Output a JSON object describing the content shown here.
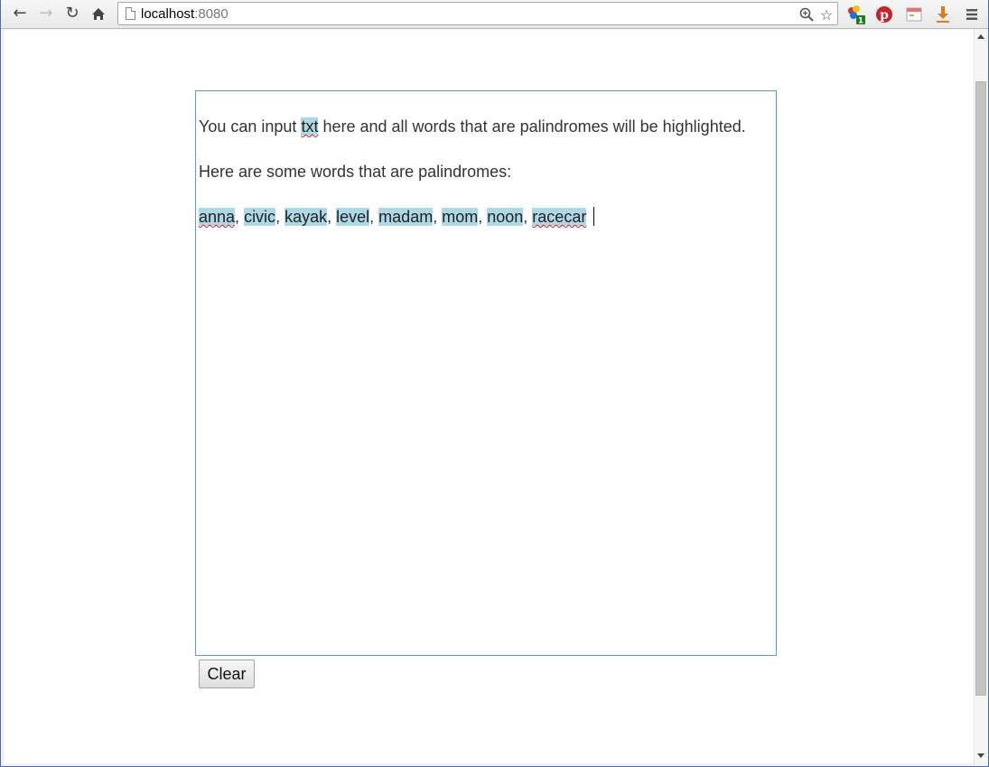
{
  "browser": {
    "url_host": "localhost",
    "url_port": ":8080",
    "icons": {
      "back": "back-arrow-icon",
      "forward": "forward-arrow-icon",
      "reload": "reload-icon",
      "home": "home-icon",
      "zoom": "zoom-icon",
      "bookmark": "star-icon",
      "menu": "hamburger-menu-icon"
    },
    "extensions": [
      {
        "name": "extension-multicolor-icon",
        "badge": "1"
      },
      {
        "name": "pinterest-icon"
      },
      {
        "name": "calendar-extension-icon"
      },
      {
        "name": "download-icon"
      }
    ]
  },
  "editor": {
    "line1": {
      "before": "You can input ",
      "highlighted": "txt",
      "after": " here and all words that are palindromes will be highlighted."
    },
    "line2": "Here are some words that are palindromes:",
    "palindromes": [
      "anna",
      "civic",
      "kayak",
      "level",
      "madam",
      "mom",
      "noon",
      "racecar"
    ],
    "separator": ", ",
    "highlight_color": "#add8e6",
    "border_color": "#5b9bd5"
  },
  "actions": {
    "clear_label": "Clear"
  }
}
